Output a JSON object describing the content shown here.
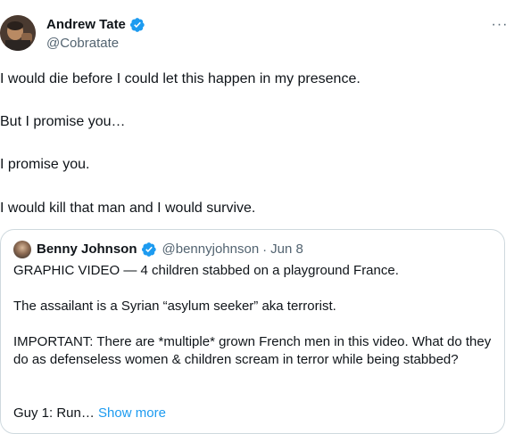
{
  "author": {
    "display_name": "Andrew Tate",
    "handle": "@Cobratate"
  },
  "tweet": {
    "lines": [
      "I would die before I could let this happen in my presence.",
      "But I promise you…",
      "I promise you.",
      "I would kill that man and I would survive."
    ]
  },
  "more_menu": {
    "glyph": "···"
  },
  "quote": {
    "display_name": "Benny Johnson",
    "handle": "@bennyjohnson",
    "separator": "·",
    "date": "Jun 8",
    "paragraphs": [
      "GRAPHIC VIDEO — 4 children stabbed on a playground France.",
      "The assailant is a Syrian “asylum seeker” aka terrorist.",
      "IMPORTANT: There are *multiple* grown French men in this video. What do they do as defenseless women & children scream in terror while being stabbed?",
      "Guy 1: Run…"
    ],
    "show_more": "Show more"
  },
  "colors": {
    "verified": "#1d9bf0",
    "secondary_text": "#536471",
    "link": "#1d9bf0",
    "border": "#cfd9de"
  },
  "icons": {
    "verified": "verified-badge-icon",
    "more": "more-horizontal-icon"
  }
}
